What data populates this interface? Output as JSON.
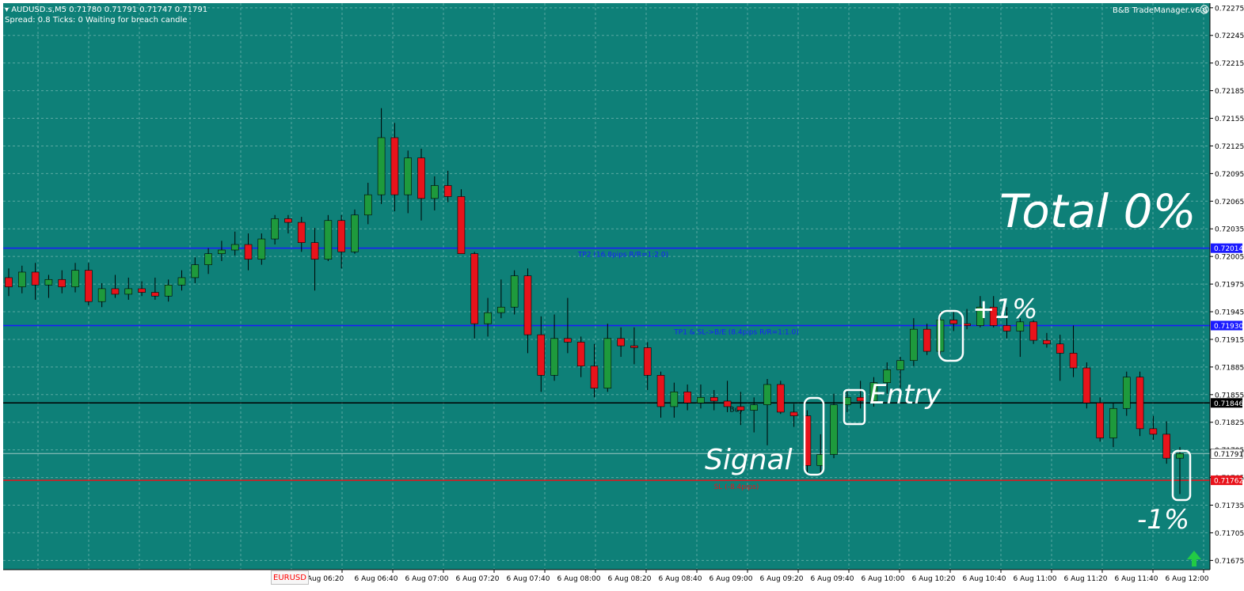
{
  "header": {
    "title": "AUDUSD.s,M5  0.71780 0.71791 0.71747 0.71791",
    "status": "Spread: 0.8   Ticks: 0   Waiting for breach candle"
  },
  "trade_manager_label": "B&B TradeManager.v6.6",
  "symbol_tab": "EURUSD",
  "colors": {
    "background": "#0e8078",
    "grid": "#5aa9a2",
    "bull": "#1e9a3c",
    "bear": "#e8131b",
    "tp_line": "#1a1aff",
    "entry_line": "#000000",
    "sl_line": "#e8131b",
    "annotation": "#ffffff"
  },
  "annotations": {
    "total": "Total 0%",
    "plus": "+1%",
    "minus": "-1%",
    "entry": "Entry",
    "signal": "Signal"
  },
  "chart_data": {
    "type": "candlestick",
    "title": "AUDUSD.s,M5",
    "ylim": [
      0.71665,
      0.7228
    ],
    "y_ticks": [
      "0.72275",
      "0.72245",
      "0.72215",
      "0.72185",
      "0.72155",
      "0.72125",
      "0.72095",
      "0.72065",
      "0.72035",
      "0.72005",
      "0.71975",
      "0.71945",
      "0.71915",
      "0.71885",
      "0.71855",
      "0.71825",
      "0.71795",
      "0.71765",
      "0.71735",
      "0.71705",
      "0.71675"
    ],
    "x_ticks": [
      "Aug 06:20",
      "6 Aug 06:40",
      "6 Aug 07:00",
      "6 Aug 07:20",
      "6 Aug 07:40",
      "6 Aug 08:00",
      "6 Aug 08:20",
      "6 Aug 08:40",
      "6 Aug 09:00",
      "6 Aug 09:20",
      "6 Aug 09:40",
      "6 Aug 10:00",
      "6 Aug 10:20",
      "6 Aug 10:40",
      "6 Aug 11:00",
      "6 Aug 11:20",
      "6 Aug 11:40",
      "6 Aug 12:00"
    ],
    "levels": [
      {
        "name": "TP2 (16.8pips R/R=1:2.0)",
        "price": 0.72014,
        "price_label": "0.72014",
        "kind": "tp"
      },
      {
        "name": "TP1 & SL->B/E (8.4pips R/R=1:1.0)",
        "price": 0.7193,
        "price_label": "0.71930",
        "kind": "tp"
      },
      {
        "name": "Buy",
        "price": 0.71846,
        "price_label": "0.71846",
        "kind": "entry"
      },
      {
        "name": "SL (-8.4pips)",
        "price": 0.71762,
        "price_label": "0.71762",
        "kind": "sl"
      }
    ],
    "current_price": 0.71791,
    "current_price_label": "0.71791",
    "candles": [
      [
        0.71982,
        0.71992,
        0.71962,
        0.71972
      ],
      [
        0.71972,
        0.71995,
        0.71965,
        0.71988
      ],
      [
        0.71988,
        0.71998,
        0.71958,
        0.71974
      ],
      [
        0.71974,
        0.71985,
        0.7196,
        0.7198
      ],
      [
        0.7198,
        0.7199,
        0.71965,
        0.71972
      ],
      [
        0.71972,
        0.71998,
        0.71966,
        0.7199
      ],
      [
        0.7199,
        0.71998,
        0.71952,
        0.71956
      ],
      [
        0.71956,
        0.71976,
        0.7195,
        0.7197
      ],
      [
        0.7197,
        0.71985,
        0.7196,
        0.71964
      ],
      [
        0.71964,
        0.71982,
        0.71958,
        0.7197
      ],
      [
        0.7197,
        0.71978,
        0.71962,
        0.71966
      ],
      [
        0.71966,
        0.71982,
        0.71958,
        0.71962
      ],
      [
        0.71962,
        0.7198,
        0.71956,
        0.71974
      ],
      [
        0.71974,
        0.7199,
        0.71968,
        0.71982
      ],
      [
        0.71982,
        0.72004,
        0.71976,
        0.71996
      ],
      [
        0.71996,
        0.72014,
        0.71986,
        0.72008
      ],
      [
        0.72008,
        0.72022,
        0.72,
        0.72012
      ],
      [
        0.72012,
        0.72032,
        0.72006,
        0.72018
      ],
      [
        0.72018,
        0.7203,
        0.7199,
        0.72002
      ],
      [
        0.72002,
        0.7203,
        0.71996,
        0.72024
      ],
      [
        0.72024,
        0.7205,
        0.72018,
        0.72046
      ],
      [
        0.72046,
        0.7205,
        0.7203,
        0.72042
      ],
      [
        0.72042,
        0.72048,
        0.7201,
        0.7202
      ],
      [
        0.7202,
        0.72036,
        0.71968,
        0.72002
      ],
      [
        0.72002,
        0.7205,
        0.72,
        0.72044
      ],
      [
        0.72044,
        0.7205,
        0.71992,
        0.7201
      ],
      [
        0.7201,
        0.72056,
        0.72008,
        0.7205
      ],
      [
        0.7205,
        0.72085,
        0.7204,
        0.72072
      ],
      [
        0.72072,
        0.72166,
        0.72062,
        0.72134
      ],
      [
        0.72134,
        0.7215,
        0.72054,
        0.72072
      ],
      [
        0.72072,
        0.7212,
        0.72052,
        0.72112
      ],
      [
        0.72112,
        0.72122,
        0.72044,
        0.72068
      ],
      [
        0.72068,
        0.72092,
        0.72055,
        0.72082
      ],
      [
        0.72082,
        0.72098,
        0.72064,
        0.7207
      ],
      [
        0.7207,
        0.72078,
        0.7205,
        0.72008
      ],
      [
        0.72008,
        0.7201,
        0.71916,
        0.71932
      ],
      [
        0.71932,
        0.7196,
        0.71918,
        0.71944
      ],
      [
        0.71944,
        0.7198,
        0.71938,
        0.7195
      ],
      [
        0.7195,
        0.7199,
        0.71942,
        0.71984
      ],
      [
        0.71984,
        0.71992,
        0.719,
        0.7192
      ],
      [
        0.7192,
        0.7194,
        0.71858,
        0.71876
      ],
      [
        0.71876,
        0.71942,
        0.7187,
        0.71916
      ],
      [
        0.71916,
        0.7196,
        0.719,
        0.71912
      ],
      [
        0.71912,
        0.71918,
        0.71874,
        0.71886
      ],
      [
        0.71886,
        0.7191,
        0.71852,
        0.71862
      ],
      [
        0.71862,
        0.71932,
        0.71858,
        0.71916
      ],
      [
        0.71916,
        0.71928,
        0.71896,
        0.71908
      ],
      [
        0.71908,
        0.71928,
        0.71888,
        0.71906
      ],
      [
        0.71906,
        0.71912,
        0.7186,
        0.71876
      ],
      [
        0.71876,
        0.7188,
        0.7183,
        0.71842
      ],
      [
        0.71842,
        0.71868,
        0.7183,
        0.71858
      ],
      [
        0.71858,
        0.71866,
        0.71838,
        0.71846
      ],
      [
        0.71846,
        0.71866,
        0.7184,
        0.71852
      ],
      [
        0.71852,
        0.7186,
        0.71838,
        0.71848
      ],
      [
        0.71848,
        0.7187,
        0.71836,
        0.71842
      ],
      [
        0.71842,
        0.71858,
        0.71822,
        0.71838
      ],
      [
        0.71838,
        0.71852,
        0.71814,
        0.71844
      ],
      [
        0.71844,
        0.71872,
        0.718,
        0.71866
      ],
      [
        0.71866,
        0.7187,
        0.71834,
        0.71836
      ],
      [
        0.71836,
        0.71845,
        0.7182,
        0.71832
      ],
      [
        0.71832,
        0.71838,
        0.7177,
        0.71778
      ],
      [
        0.71778,
        0.71812,
        0.7177,
        0.7179
      ],
      [
        0.7179,
        0.71856,
        0.71786,
        0.71844
      ],
      [
        0.71844,
        0.7186,
        0.71836,
        0.71852
      ],
      [
        0.71852,
        0.7187,
        0.7184,
        0.71848
      ],
      [
        0.71848,
        0.71874,
        0.71842,
        0.71868
      ],
      [
        0.71868,
        0.7189,
        0.71856,
        0.71882
      ],
      [
        0.71882,
        0.71896,
        0.71862,
        0.71892
      ],
      [
        0.71892,
        0.71938,
        0.71886,
        0.71926
      ],
      [
        0.71926,
        0.71932,
        0.71898,
        0.71902
      ],
      [
        0.71902,
        0.71945,
        0.71896,
        0.71936
      ],
      [
        0.71936,
        0.71945,
        0.71924,
        0.71932
      ],
      [
        0.71932,
        0.71948,
        0.71926,
        0.7193
      ],
      [
        0.7193,
        0.71962,
        0.71928,
        0.7195
      ],
      [
        0.7195,
        0.71962,
        0.71928,
        0.7193
      ],
      [
        0.7193,
        0.7195,
        0.71916,
        0.71924
      ],
      [
        0.71924,
        0.71938,
        0.71896,
        0.71934
      ],
      [
        0.71934,
        0.71936,
        0.7191,
        0.71914
      ],
      [
        0.71914,
        0.71922,
        0.71906,
        0.7191
      ],
      [
        0.7191,
        0.7192,
        0.7187,
        0.719
      ],
      [
        0.719,
        0.7193,
        0.71874,
        0.71884
      ],
      [
        0.71884,
        0.7189,
        0.7184,
        0.71846
      ],
      [
        0.71846,
        0.71852,
        0.71804,
        0.71808
      ],
      [
        0.71808,
        0.71846,
        0.71798,
        0.7184
      ],
      [
        0.7184,
        0.7188,
        0.71832,
        0.71874
      ],
      [
        0.71874,
        0.7188,
        0.7181,
        0.71818
      ],
      [
        0.71818,
        0.71832,
        0.71806,
        0.71812
      ],
      [
        0.71812,
        0.71826,
        0.7178,
        0.71786
      ],
      [
        0.71786,
        0.71798,
        0.71747,
        0.71791
      ]
    ]
  }
}
